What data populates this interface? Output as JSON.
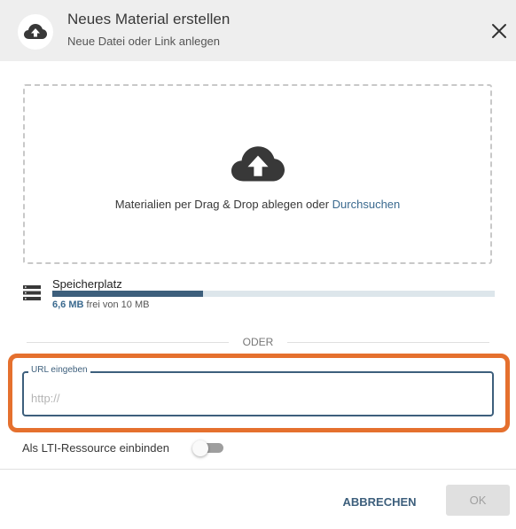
{
  "header": {
    "title": "Neues Material erstellen",
    "subtitle": "Neue Datei oder Link anlegen",
    "icon": "cloud-upload-icon",
    "close_icon": "close-icon"
  },
  "dropzone": {
    "text": "Materialien per Drag & Drop ablegen oder ",
    "browse_link": "Durchsuchen",
    "icon": "cloud-upload-icon"
  },
  "storage": {
    "title": "Speicherplatz",
    "free_value": "6,6 MB",
    "free_suffix": " frei von 10 MB",
    "used_fraction": 0.34,
    "icon": "storage-icon"
  },
  "divider": {
    "label": "ODER"
  },
  "url": {
    "label": "URL eingeben",
    "placeholder": "http://",
    "value": ""
  },
  "lti": {
    "label": "Als LTI-Ressource einbinden",
    "enabled": false
  },
  "footer": {
    "cancel_label": "ABBRECHEN",
    "ok_label": "OK"
  },
  "colors": {
    "accent": "#3d5f7c",
    "link": "#3b6a8f",
    "highlight": "#e5702e",
    "header_bg": "#eeeeee"
  }
}
